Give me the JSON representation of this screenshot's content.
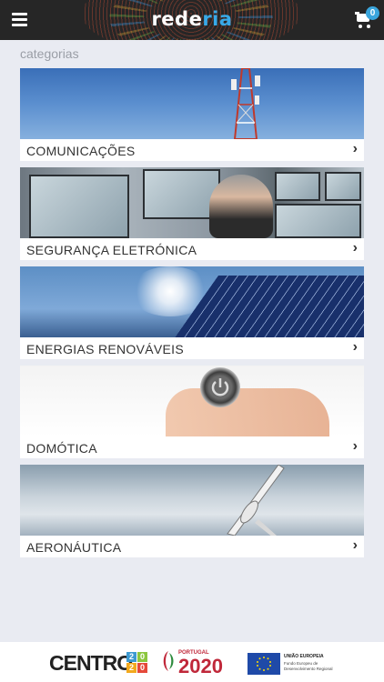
{
  "header": {
    "logo_main": "rede",
    "logo_accent": "ria",
    "cart_count": "0",
    "menu_icon": "hamburger-icon",
    "cart_icon": "cart-icon"
  },
  "section_title": "categorias",
  "categories": [
    {
      "label": "COMUNICAÇÕES",
      "chevron": "›"
    },
    {
      "label": "SEGURANÇA ELETRÓNICA",
      "chevron": "›"
    },
    {
      "label": "ENERGIAS RENOVÁVEIS",
      "chevron": "›"
    },
    {
      "label": "DOMÓTICA",
      "chevron": "›"
    },
    {
      "label": "AERONÁUTICA",
      "chevron": "›"
    }
  ],
  "footer": {
    "centro_text": "CENTRO",
    "centro_grid": [
      "2",
      "0",
      "2",
      "0"
    ],
    "portugal_label": "PORTUGAL",
    "portugal_year": "2020",
    "eu_title": "UNIÃO EUROPEIA",
    "eu_subtitle": "Fundo Europeu de Desenvolvimento Regional"
  },
  "colors": {
    "topbar": "#262626",
    "accent": "#38a9e8",
    "background": "#e9ebf2",
    "portugal_red": "#c0283a",
    "eu_blue": "#1f4aa8"
  }
}
